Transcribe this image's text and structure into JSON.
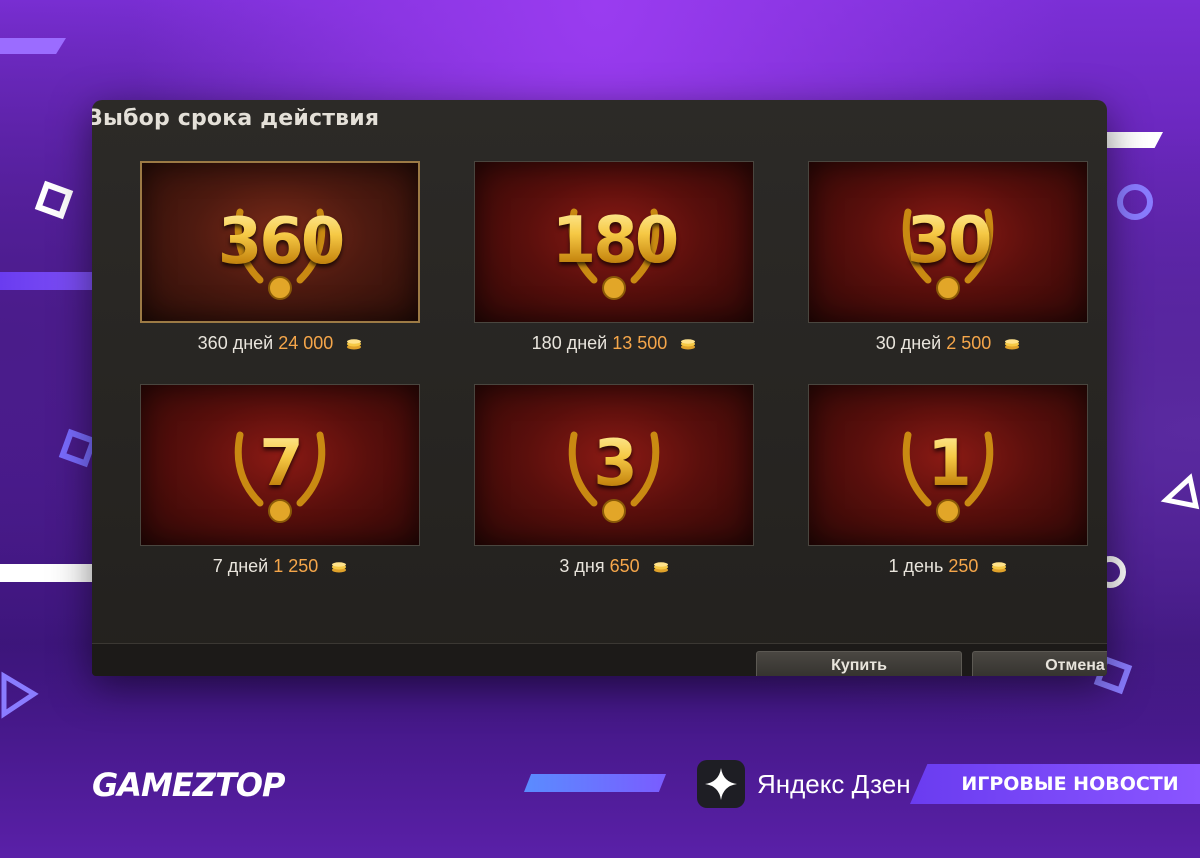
{
  "dialog": {
    "title": "Выбор срока действия",
    "options": [
      {
        "number": "360",
        "days_label": "360 дней",
        "price": "24 000",
        "selected": true
      },
      {
        "number": "180",
        "days_label": "180 дней",
        "price": "13 500",
        "selected": false
      },
      {
        "number": "30",
        "days_label": "30 дней",
        "price": "2 500",
        "selected": false
      },
      {
        "number": "7",
        "days_label": "7 дней",
        "price": "1 250",
        "selected": false
      },
      {
        "number": "3",
        "days_label": "3 дня",
        "price": "650",
        "selected": false
      },
      {
        "number": "1",
        "days_label": "1 день",
        "price": "250",
        "selected": false
      }
    ],
    "buy_label": "Купить",
    "cancel_label": "Отмена"
  },
  "branding": {
    "logo_text": "GAMEZTOP",
    "zen_text": "Яндекс Дзен",
    "news_tag": "ИГРОВЫЕ НОВОСТИ"
  },
  "colors": {
    "accent_purple": "#7b2fd6",
    "price_orange": "#f5a64a",
    "gold": "#f4c542"
  },
  "icons": {
    "currency": "gold-coin-icon",
    "wreath": "laurel-wreath-icon"
  }
}
